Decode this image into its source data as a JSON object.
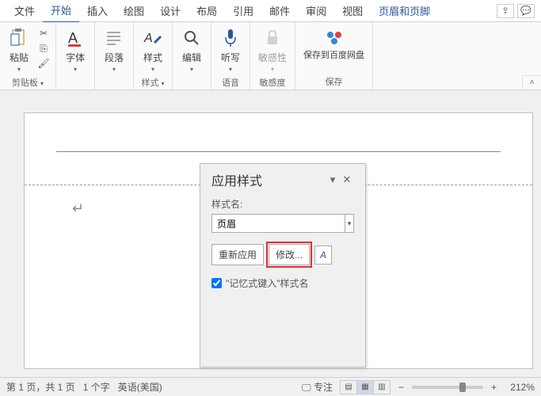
{
  "tabs": {
    "file": "文件",
    "home": "开始",
    "insert": "插入",
    "draw": "绘图",
    "design": "设计",
    "layout": "布局",
    "references": "引用",
    "mailings": "邮件",
    "review": "审阅",
    "view": "视图",
    "headerfooter": "页眉和页脚"
  },
  "ribbon": {
    "paste": "粘贴",
    "clipboard": "剪贴板",
    "font": "字体",
    "paragraph": "段落",
    "styles": "样式",
    "styles_group": "样式",
    "editing": "编辑",
    "dictate": "听写",
    "voice": "语音",
    "sensitivity": "敏感性",
    "sensitivity_group": "敏感度",
    "save_baidu": "保存到百度网盘",
    "save_group": "保存"
  },
  "pane": {
    "title": "应用样式",
    "style_name_label": "样式名:",
    "style_value": "页眉",
    "reapply": "重新应用",
    "modify": "修改...",
    "checkbox_label": "\"记忆式键入\"样式名"
  },
  "status": {
    "page_info": "第 1 页，共 1 页",
    "word_count": "1 个字",
    "language": "英语(美国)",
    "focus": "专注",
    "zoom": "212%"
  }
}
